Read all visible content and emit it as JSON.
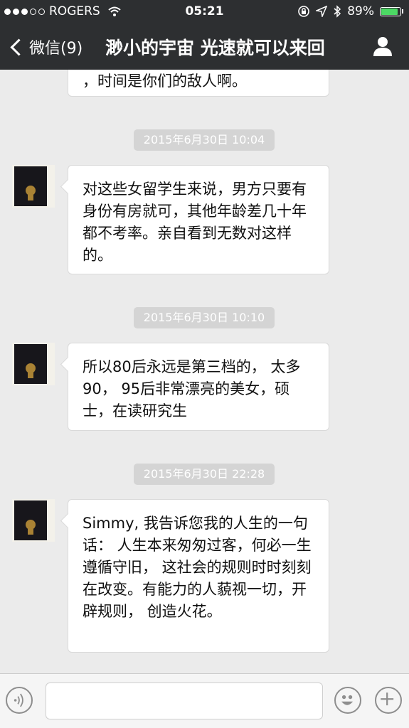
{
  "status_bar": {
    "carrier": "ROGERS",
    "time": "05:21",
    "battery": "89%",
    "battery_level": 0.89,
    "battery_color": "#4cd964"
  },
  "nav": {
    "back_label": "微信(9)",
    "title": "渺小的宇宙 光速就可以来回"
  },
  "messages": [
    {
      "type": "text",
      "text": "，时间是你们的敌人啊。"
    },
    {
      "type": "time",
      "text": "2015年6月30日 10:04"
    },
    {
      "type": "text",
      "text": "对这些女留学生来说，男方只要有身份有房就可，其他年龄差几十年都不考率。亲自看到无数对这样的。"
    },
    {
      "type": "time",
      "text": "2015年6月30日 10:10"
    },
    {
      "type": "text",
      "text": "所以80后永远是第三档的， 太多90， 95后非常漂亮的美女，硕士，在读研究生"
    },
    {
      "type": "time",
      "text": "2015年6月30日 22:28"
    },
    {
      "type": "text",
      "text": "Simmy, 我告诉您我的人生的一句话： 人生本来匆匆过客，何必一生遵循守旧， 这社会的规则时时刻刻在改变。有能力的人藐视一切，开辟规则， 创造火花。"
    }
  ],
  "input": {
    "placeholder": ""
  },
  "icons": [
    "back-chevron-icon",
    "person-icon",
    "voice-icon",
    "emoji-icon",
    "plus-icon",
    "wifi-icon",
    "bluetooth-icon",
    "location-icon",
    "lock-rotation-icon"
  ],
  "colors": {
    "header_bg": "#2d2f31",
    "chat_bg": "#ebebeb",
    "timestamp_bg": "#d4d4d4"
  }
}
